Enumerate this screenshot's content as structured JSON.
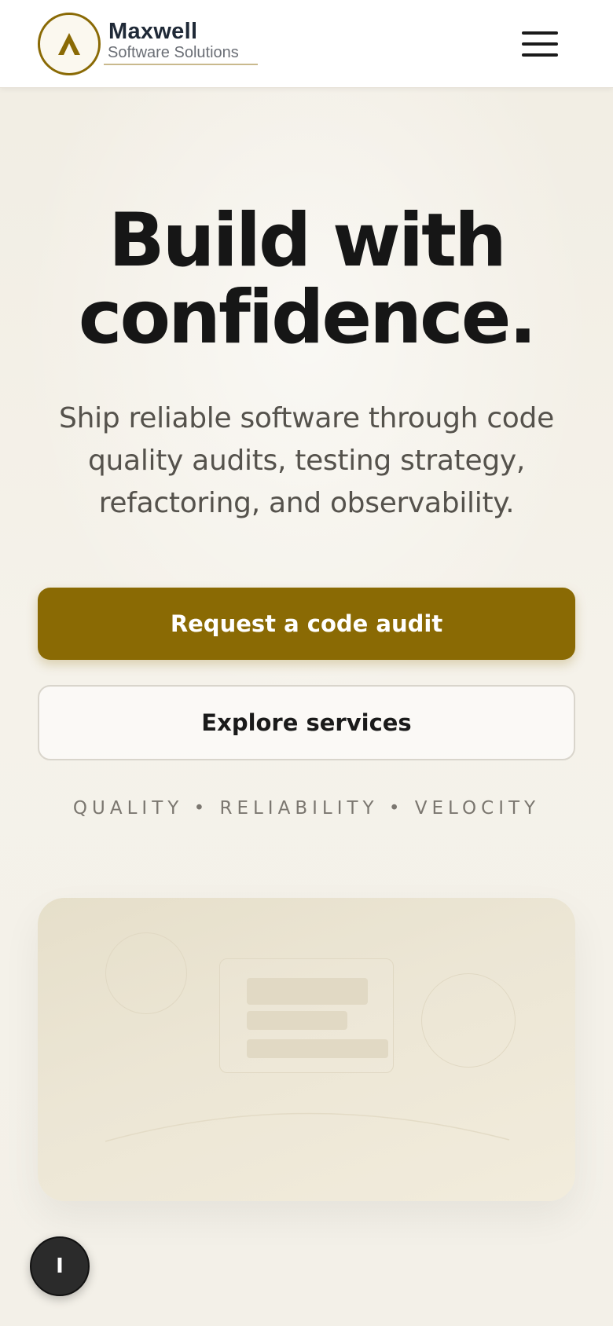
{
  "header": {
    "brand_name": "Maxwell",
    "brand_sub": "Software Solutions",
    "logo_icon": "chevron-up-logo",
    "menu_icon": "hamburger-menu-icon"
  },
  "hero": {
    "title_line1": "Build with",
    "title_line2": "confidence.",
    "subtitle": "Ship reliable software through code quality audits, testing strategy, refactoring, and observability.",
    "primary_cta": "Request a code audit",
    "secondary_cta": "Explore services",
    "tagline": "QUALITY • RELIABILITY • VELOCITY"
  },
  "floating_button": {
    "label": "I"
  },
  "colors": {
    "accent": "#8a6a04",
    "text_dark": "#161616",
    "background": "#f5f2ea"
  }
}
